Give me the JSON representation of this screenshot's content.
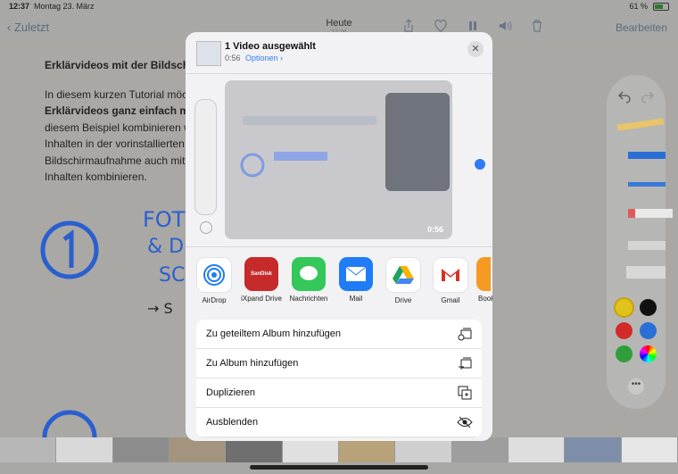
{
  "status": {
    "time": "12:37",
    "date": "Montag 23. März",
    "battery": "61 %"
  },
  "nav": {
    "back_label": "Zuletzt",
    "title": "Heute",
    "subtitle": "12:36",
    "edit_label": "Bearbeiten"
  },
  "note": {
    "heading": "Erklärvideos mit der Bildschi",
    "lines": [
      "In diesem kurzen Tutorial möch",
      "Erklärvideos ganz einfach mit",
      "diesem Beispiel kombinieren w",
      "Inhalten in der vorinstallierten",
      "Bildschirmaufnahme auch mit",
      "Inhalten kombinieren."
    ],
    "handwriting": [
      "FOTO",
      "& D",
      "SC",
      "→ S"
    ]
  },
  "sheet": {
    "title": "1 Video ausgewählt",
    "duration": "0:56",
    "options_label": "Optionen",
    "preview_duration": "0:56",
    "apps": [
      {
        "label": "AirDrop",
        "icon": "airdrop-icon"
      },
      {
        "label": "iXpand Drive",
        "icon": "sandisk-icon"
      },
      {
        "label": "Nachrichten",
        "icon": "messages-icon"
      },
      {
        "label": "Mail",
        "icon": "mail-icon"
      },
      {
        "label": "Drive",
        "icon": "google-drive-icon"
      },
      {
        "label": "Gmail",
        "icon": "gmail-icon"
      },
      {
        "label": "Book",
        "icon": "books-icon"
      }
    ],
    "actions": [
      {
        "label": "Zu geteiltem Album hinzufügen",
        "icon": "shared-album-add-icon"
      },
      {
        "label": "Zu Album hinzufügen",
        "icon": "album-add-icon"
      },
      {
        "label": "Duplizieren",
        "icon": "duplicate-icon"
      },
      {
        "label": "Ausblenden",
        "icon": "eye-slash-icon"
      }
    ]
  },
  "colors": {
    "accent": "#2f7cf6",
    "palette_colors": [
      "#e0c21c",
      "#111111",
      "#d22a2a",
      "#2a6fd6",
      "#2f9e3a"
    ]
  }
}
